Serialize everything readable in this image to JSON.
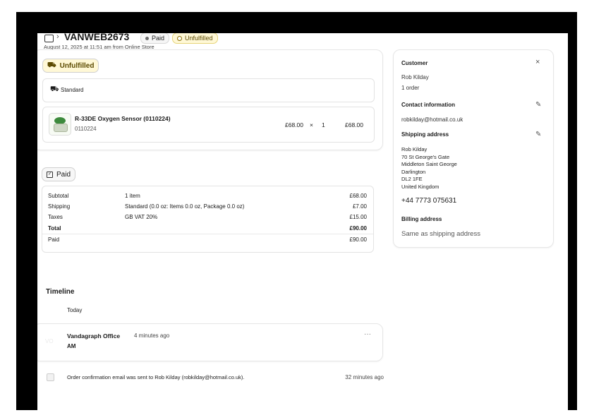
{
  "header": {
    "order_id": "VANWEB2673",
    "paid_badge": "Paid",
    "unfulfilled_badge": "Unfulfilled",
    "subtitle": "August 12, 2025 at 11:51 am from Online Store"
  },
  "fulfillment": {
    "status_label": "Unfulfilled",
    "shipping_method": "Standard",
    "item": {
      "name": "R-33DE Oxygen Sensor (0110224)",
      "sku": "0110224",
      "unit_price": "£68.00",
      "times": "×",
      "quantity": "1",
      "total": "£68.00"
    }
  },
  "payment": {
    "status_label": "Paid",
    "rows": [
      {
        "label": "Subtotal",
        "detail": "1 item",
        "amount": "£68.00"
      },
      {
        "label": "Shipping",
        "detail": "Standard (0.0 oz: Items 0.0 oz, Package 0.0 oz)",
        "amount": "£7.00"
      },
      {
        "label": "Taxes",
        "detail": "GB VAT 20%",
        "amount": "£15.00"
      },
      {
        "label": "Total",
        "detail": "",
        "amount": "£90.00"
      },
      {
        "label": "Paid",
        "detail": "",
        "amount": "£90.00"
      }
    ]
  },
  "timeline": {
    "title": "Timeline",
    "today_label": "Today",
    "entry": {
      "avatar": "VO",
      "author": "Vandagraph Office",
      "time": "4 minutes ago",
      "body": "AM",
      "menu": "···"
    },
    "event": {
      "text": "Order confirmation email was sent to Rob Kilday (robkilday@hotmail.co.uk).",
      "time": "32 minutes ago"
    }
  },
  "customer": {
    "title": "Customer",
    "close": "×",
    "name": "Rob Kilday",
    "orders": "1 order",
    "contact_title": "Contact information",
    "email": "robkilday@hotmail.co.uk",
    "shipping_title": "Shipping address",
    "address": [
      "Rob Kilday",
      "70 St George's Gate",
      "Middleton Saint George",
      "Darlington",
      "DL2 1FE",
      "United Kingdom"
    ],
    "phone": "+44 7773 075631",
    "billing_title": "Billing address",
    "billing_value": "Same as shipping address"
  },
  "colors": {
    "unfulfilled_bg": "#fff8d6",
    "unfulfilled_border": "#e6d47a"
  }
}
